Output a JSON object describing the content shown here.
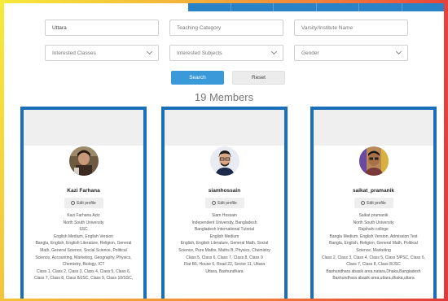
{
  "filters": {
    "location_value": "Uttara",
    "teaching_category_placeholder": "Teaching Category",
    "varsity_placeholder": "Varsity/Institute Name",
    "interested_classes_placeholder": "Interested Classes",
    "interested_subjects_placeholder": "Interested Subjects",
    "gender_placeholder": "Gender"
  },
  "buttons": {
    "search_label": "Search",
    "reset_label": "Reset"
  },
  "members_title": "19 Members",
  "cards": [
    {
      "name": "Kazi Farhana",
      "edit_label": "Edit profile",
      "details": [
        "Kazi Farhana Aziz",
        "North South University",
        "SSC",
        "English Medium, English Version",
        "Bangla, English, English Literature, Religion, General",
        "Math, General Science, Social Science, Political",
        "Science, Accounting, Marketing, Geography, Physics,",
        "Chemistry, Biology, ICT",
        "Class 1, Class 2, Class 3, Class 4, Class 5, Class 6,",
        "Class 7, Class 8, Class 8/JSC, Class 9, Class 10/SSC,"
      ]
    },
    {
      "name": "siamhossain",
      "edit_label": "Edit profile",
      "details": [
        "Siam Hossain",
        "Independent University, Bangladesh",
        "Bangladesh International Tutorial",
        "English Medium",
        "English, English Literature, General Math, Social",
        "Science, Pure Maths, Maths B, Physics, Chemistry",
        "Class 5, Class 6, Class 7, Class 8, Class 9",
        "Flat B6, House 6, Road 22, Sector 11, Uttara",
        "Uttara, Bashundhara"
      ]
    },
    {
      "name": "saikat_pramanik",
      "edit_label": "Edit profile",
      "details": [
        "Saikat pramanik",
        "North South University",
        "Rajshahi college",
        "Bangla Medium, English Version, Admission Test",
        "Bangla, English, Religion, General Math, Political",
        "Science, Marketing",
        "Class 2, Class 3, Class 4, Class 5, Class 5/PSC, Class 6,",
        "Class 7, Class 8, Class 8/JSC",
        "Bashundhara abasik area,natara,Dhaka,Bangladesh",
        "Bashundhara abasik area,uttara,dhaka,uttara"
      ]
    }
  ]
}
